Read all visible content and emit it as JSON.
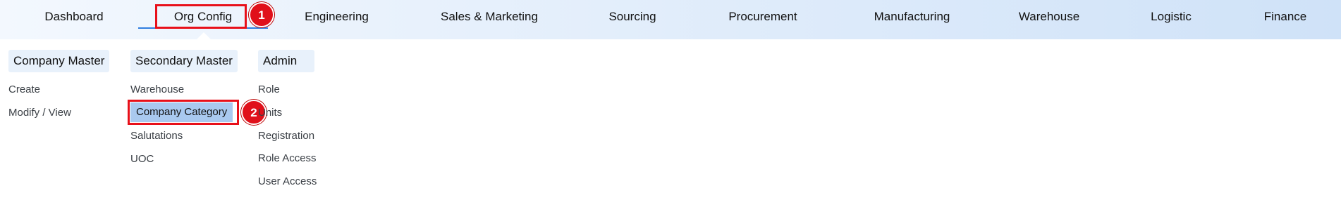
{
  "nav": {
    "items": [
      {
        "label": "Dashboard"
      },
      {
        "label": "Org Config"
      },
      {
        "label": "Engineering"
      },
      {
        "label": "Sales & Marketing"
      },
      {
        "label": "Sourcing"
      },
      {
        "label": "Procurement"
      },
      {
        "label": "Manufacturing"
      },
      {
        "label": "Warehouse"
      },
      {
        "label": "Logistic"
      },
      {
        "label": "Finance"
      }
    ]
  },
  "steps": {
    "one": "1",
    "two": "2"
  },
  "dropdown": {
    "groups": [
      {
        "title": "Company Master",
        "items": [
          "Create",
          "Modify / View"
        ]
      },
      {
        "title": "Secondary Master",
        "items": [
          "Warehouse",
          "Company Category",
          "Salutations",
          "UOC"
        ]
      },
      {
        "title": "Admin",
        "items": [
          "Role",
          "Units",
          "Registration",
          "Role Access",
          "User Access"
        ]
      }
    ]
  },
  "colors": {
    "accent": "#2f7de0",
    "highlight": "#e8101a",
    "selected_bg": "#a9c9ef"
  }
}
